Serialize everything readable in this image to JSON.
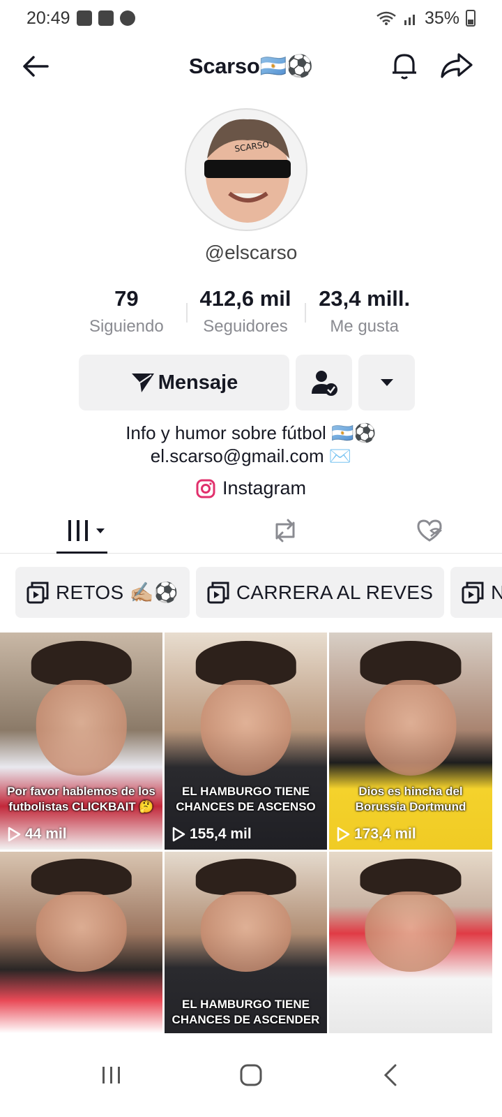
{
  "status_bar": {
    "time": "20:49",
    "battery": "35%"
  },
  "header": {
    "title": "Scarso🇦🇷⚽"
  },
  "profile": {
    "handle": "@elscarso",
    "stats": [
      {
        "value": "79",
        "label": "Siguiendo"
      },
      {
        "value": "412,6 mil",
        "label": "Seguidores"
      },
      {
        "value": "23,4 mill.",
        "label": "Me gusta"
      }
    ],
    "message_label": "Mensaje",
    "bio_line1": "Info y humor sobre fútbol 🇦🇷⚽",
    "bio_line2": "el.scarso@gmail.com ✉️",
    "link_label": "Instagram"
  },
  "playlists": [
    {
      "label": "RETOS ✍🏼⚽"
    },
    {
      "label": "CARRERA AL REVES"
    },
    {
      "label": "N"
    }
  ],
  "videos": [
    {
      "caption": "Por favor hablemos de los futbolistas CLICKBAIT 🤔",
      "views": "44 mil"
    },
    {
      "caption": "EL HAMBURGO TIENE CHANCES DE ASCENSO",
      "views": "155,4 mil"
    },
    {
      "caption": "Dios es hincha del Borussia Dortmund",
      "views": "173,4 mil"
    },
    {
      "caption": "",
      "views": ""
    },
    {
      "caption": "EL HAMBURGO TIENE CHANCES DE ASCENDER",
      "views": ""
    },
    {
      "caption": "",
      "views": ""
    }
  ],
  "colors": {
    "text": "#161823",
    "muted": "#8a8b91",
    "button_bg": "#f1f1f2",
    "instagram": "#e1306c"
  }
}
